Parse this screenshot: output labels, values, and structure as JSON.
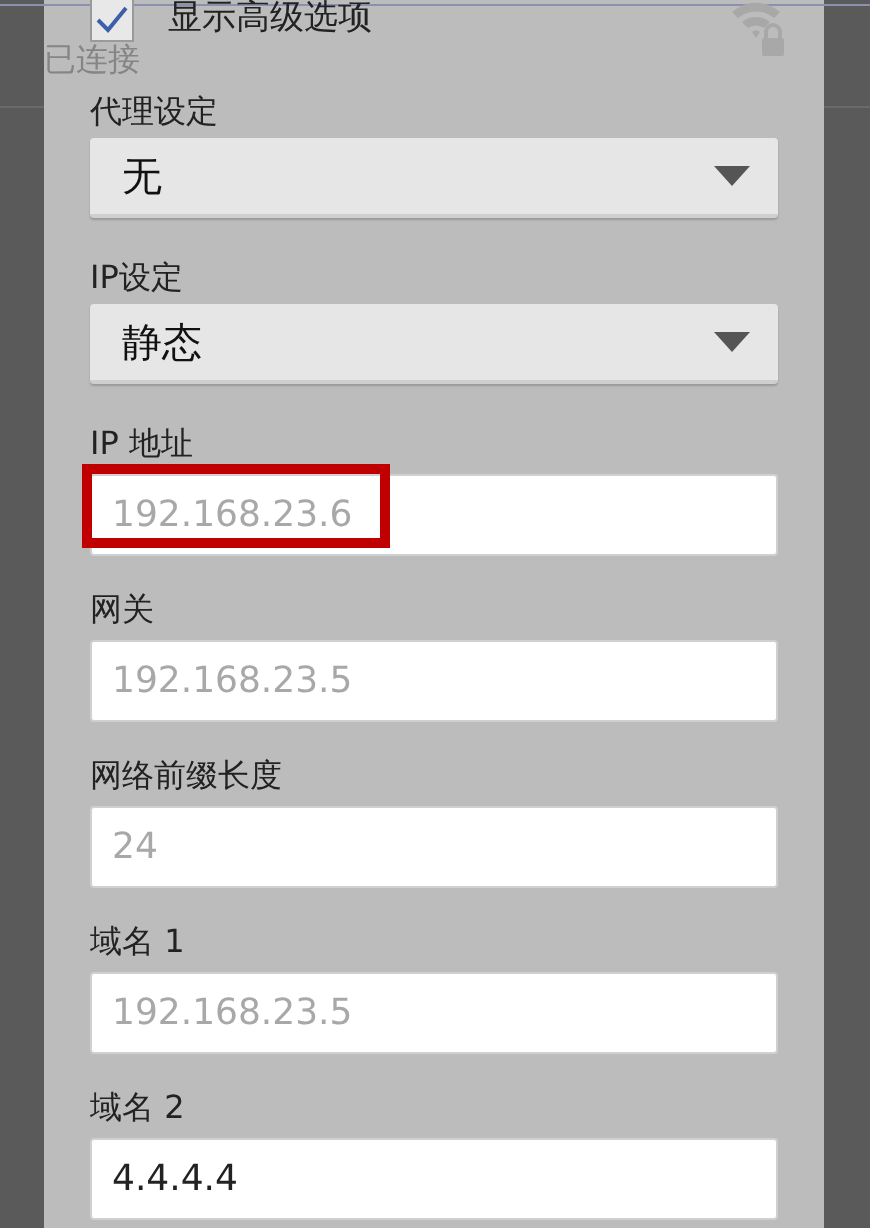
{
  "background": {
    "status": "已连接"
  },
  "advanced_options": {
    "label": "显示高级选项",
    "checked": true
  },
  "fields": [
    {
      "kind": "dropdown",
      "label": "代理设定",
      "value": "无"
    },
    {
      "kind": "dropdown",
      "label": "IP设定",
      "value": "静态"
    },
    {
      "kind": "input",
      "label": "IP 地址",
      "placeholder": "192.168.23.6",
      "highlighted": true
    },
    {
      "kind": "input",
      "label": "网关",
      "placeholder": "192.168.23.5",
      "highlighted": false
    },
    {
      "kind": "input",
      "label": "网络前缀长度",
      "placeholder": "24",
      "highlighted": false
    },
    {
      "kind": "input",
      "label": "域名 1",
      "placeholder": "192.168.23.5",
      "highlighted": false
    },
    {
      "kind": "input",
      "label": "域名 2",
      "value": "4.4.4.4",
      "highlighted": false
    }
  ]
}
